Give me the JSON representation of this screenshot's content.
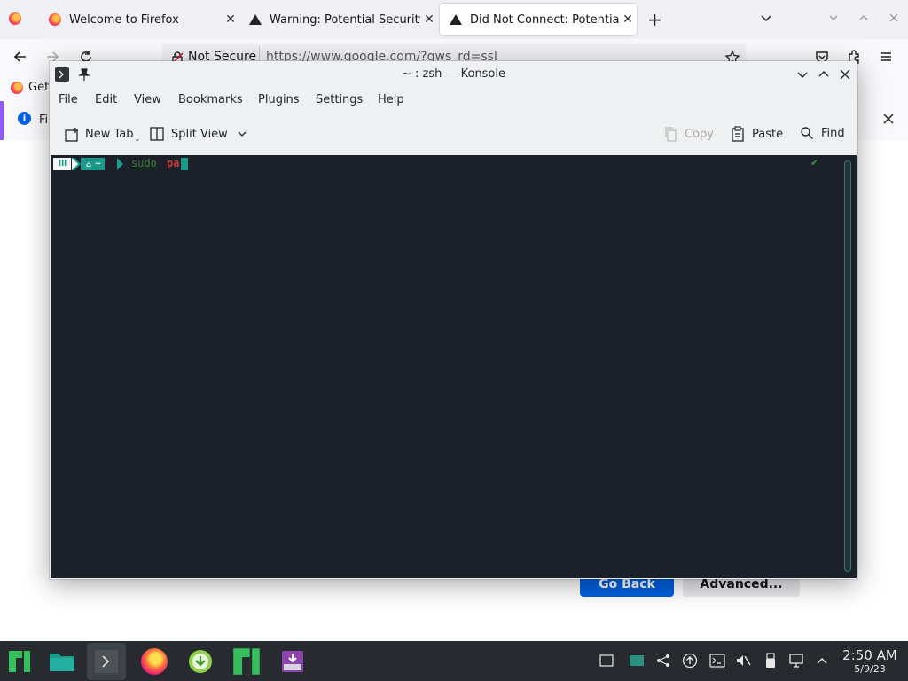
{
  "firefox": {
    "tabs": [
      {
        "label": "Welcome to Firefox",
        "icon": "firefox-icon"
      },
      {
        "label": "Warning: Potential Security",
        "icon": "warning-icon"
      },
      {
        "label": "Did Not Connect: Potential",
        "icon": "warning-icon",
        "active": true
      }
    ],
    "url_prefix": "Not Secure",
    "url": "https://www.google.com/?gws_rd=ssl",
    "bookmark_label": "Get",
    "info_text": "Fi",
    "go_back_label": "Go Back",
    "advanced_label": "Advanced..."
  },
  "konsole": {
    "title": "~ : zsh — Konsole",
    "menu": [
      "File",
      "Edit",
      "View",
      "Bookmarks",
      "Plugins",
      "Settings",
      "Help"
    ],
    "toolbar": {
      "new_tab": "New Tab",
      "split_view": "Split View",
      "copy": "Copy",
      "paste": "Paste",
      "find": "Find"
    },
    "terminal": {
      "prompt_logo": "lll",
      "prompt_path": "~",
      "command_word": "sudo",
      "command_arg": "pa",
      "status_mark": "✔"
    },
    "colors": {
      "terminal_bg": "#1c2028",
      "prompt_teal": "#1b998b",
      "command_green": "#3f7a3a",
      "command_red": "#c63b3b"
    }
  },
  "taskbar": {
    "clock_time": "2:50 AM",
    "clock_date": "5/9/23"
  }
}
